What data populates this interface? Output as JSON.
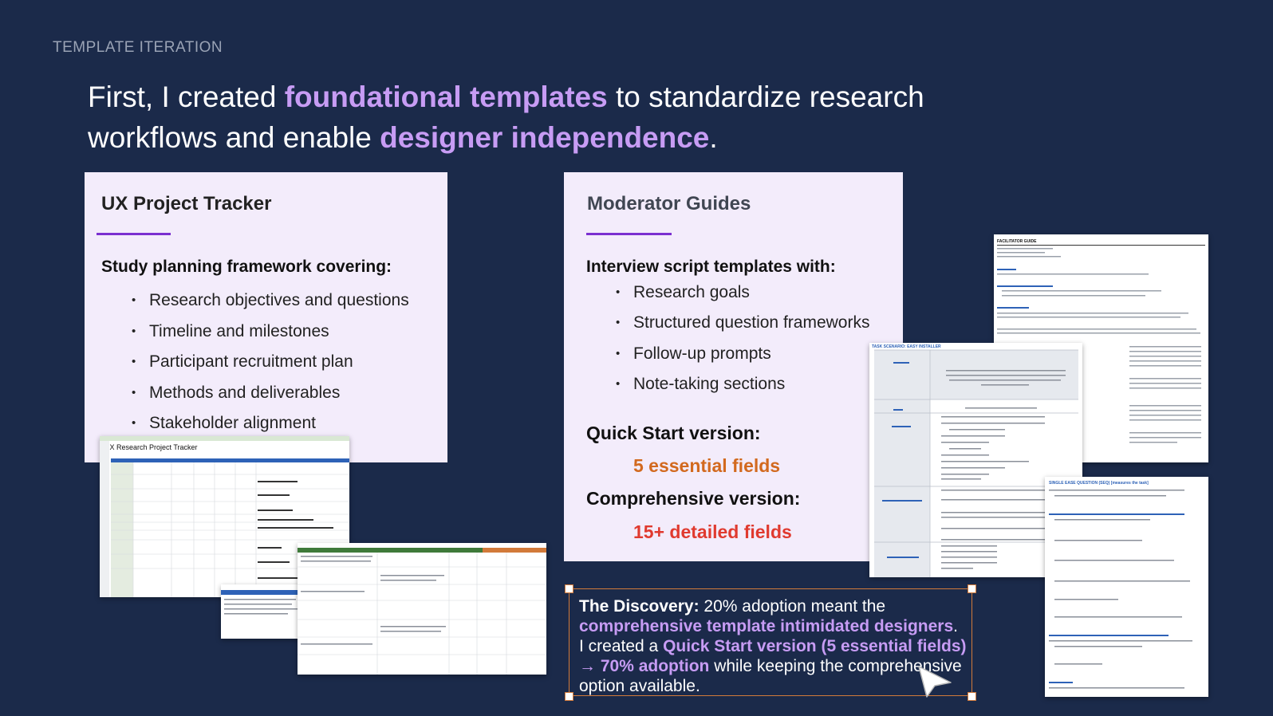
{
  "eyebrow": "TEMPLATE ITERATION",
  "headline": {
    "part1": "First, I created ",
    "hl1": "foundational templates",
    "part2": " to standardize research workflows and enable ",
    "hl2": "designer independence",
    "part3": "."
  },
  "tracker": {
    "title": "UX Project Tracker",
    "subtitle": "Study planning framework covering:",
    "items": [
      "Research objectives and questions",
      "Timeline and milestones",
      "Participant recruitment plan",
      "Methods and deliverables",
      "Stakeholder alignment"
    ],
    "sheet_title": "UX Research Project Tracker"
  },
  "moderator": {
    "title": "Moderator Guides",
    "subtitle": "Interview script templates with:",
    "items": [
      "Research goals",
      "Structured question frameworks",
      "Follow-up prompts",
      "Note-taking sections"
    ],
    "quick_label": "Quick Start version:",
    "quick_fields": "5 essential fields",
    "comp_label": "Comprehensive version:",
    "comp_fields": "15+ detailed fields",
    "doc_head": "FACILITATOR GUIDE",
    "task_head": "TASK SCENARIO: EASY INSTALLER",
    "seq_head": "SINGLE EASE QUESTION (SEQ) [measures the task]"
  },
  "discovery": {
    "lead": "The Discovery:",
    "t1": " 20% adoption meant the ",
    "hl1": "comprehensive template intimidated designers",
    "t2": ". I created a ",
    "hl2": "Quick Start version (5 essential fields) → 70% adoption",
    "t3": " while keeping the comprehensive option available."
  },
  "colors": {
    "background": "#1b2a4a",
    "card": "#f3ecfb",
    "accent_purple": "#c79cf4",
    "underline": "#7b2fd0",
    "quick_orange": "#d2691e",
    "comp_red": "#e03a2f",
    "selection_border": "#d27a3a"
  }
}
